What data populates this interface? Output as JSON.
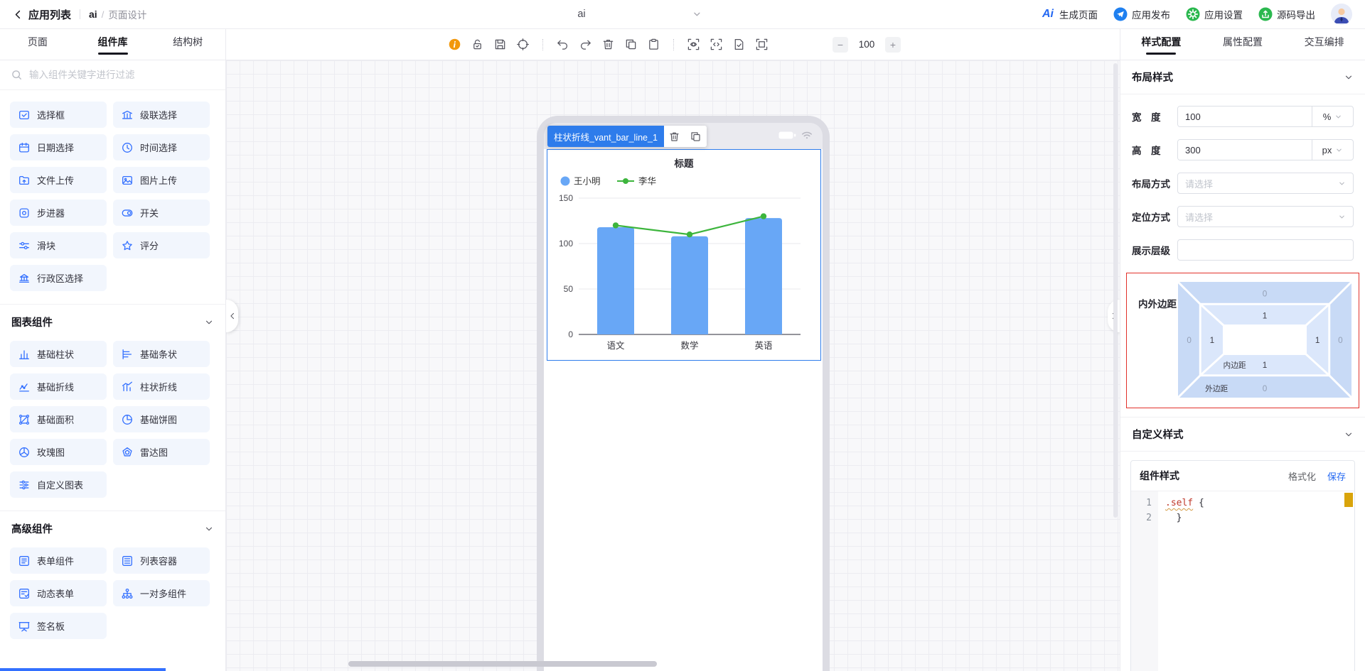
{
  "topbar": {
    "back_label": "应用列表",
    "app_name": "ai",
    "breadcrumb_divider": "/",
    "page_label": "页面设计",
    "center_title": "ai",
    "logo_text": "Ai",
    "actions": [
      {
        "id": "generate-page",
        "icon": "ai-logo",
        "label": "生成页面"
      },
      {
        "id": "app-publish",
        "icon": "publish",
        "label": "应用发布"
      },
      {
        "id": "app-settings",
        "icon": "settings",
        "label": "应用设置"
      },
      {
        "id": "source-export",
        "icon": "export",
        "label": "源码导出"
      }
    ]
  },
  "left_panel": {
    "tabs": [
      {
        "label": "页面",
        "active": false
      },
      {
        "label": "组件库",
        "active": true
      },
      {
        "label": "结构树",
        "active": false
      }
    ],
    "search_placeholder": "输入组件关键字进行过滤",
    "groups": [
      {
        "header": "",
        "items": [
          {
            "icon": "checkbox",
            "label": "选择框"
          },
          {
            "icon": "cascade",
            "label": "级联选择"
          },
          {
            "icon": "calendar",
            "label": "日期选择"
          },
          {
            "icon": "clock",
            "label": "时间选择"
          },
          {
            "icon": "file-upload",
            "label": "文件上传"
          },
          {
            "icon": "image-upload",
            "label": "图片上传"
          },
          {
            "icon": "stepper",
            "label": "步进器"
          },
          {
            "icon": "switch",
            "label": "开关"
          },
          {
            "icon": "slider",
            "label": "滑块"
          },
          {
            "icon": "star",
            "label": "评分"
          },
          {
            "icon": "district",
            "label": "行政区选择"
          }
        ]
      },
      {
        "header": "图表组件",
        "items": [
          {
            "icon": "bar-chart",
            "label": "基础柱状"
          },
          {
            "icon": "hbar-chart",
            "label": "基础条状"
          },
          {
            "icon": "line-chart",
            "label": "基础折线"
          },
          {
            "icon": "bar-line-chart",
            "label": "柱状折线"
          },
          {
            "icon": "area-chart",
            "label": "基础面积"
          },
          {
            "icon": "pie-chart",
            "label": "基础饼图"
          },
          {
            "icon": "rose-chart",
            "label": "玫瑰图"
          },
          {
            "icon": "radar-chart",
            "label": "雷达图"
          },
          {
            "icon": "custom-chart",
            "label": "自定义图表"
          }
        ]
      },
      {
        "header": "高级组件",
        "items": [
          {
            "icon": "form",
            "label": "表单组件"
          },
          {
            "icon": "list-container",
            "label": "列表容器"
          },
          {
            "icon": "dynamic-form",
            "label": "动态表单"
          },
          {
            "icon": "one-to-many",
            "label": "一对多组件"
          },
          {
            "icon": "signature",
            "label": "签名板"
          }
        ]
      }
    ]
  },
  "canvas_toolbar": {
    "icons": [
      {
        "name": "info"
      },
      {
        "name": "unlock"
      },
      {
        "name": "save"
      },
      {
        "name": "target",
        "divider_after": true
      },
      {
        "name": "undo"
      },
      {
        "name": "redo"
      },
      {
        "name": "delete"
      },
      {
        "name": "copy"
      },
      {
        "name": "paste",
        "divider_after": true
      },
      {
        "name": "preview-scan"
      },
      {
        "name": "code-scan"
      },
      {
        "name": "doc-check"
      },
      {
        "name": "frame-select"
      }
    ],
    "zoom": {
      "minus": "−",
      "value": "100",
      "plus": "+"
    }
  },
  "canvas": {
    "selected_component": "柱状折线_vant_bar_line_1"
  },
  "chart_data": {
    "type": "bar+line combo",
    "title": "标题",
    "categories": [
      "语文",
      "数学",
      "英语"
    ],
    "series": [
      {
        "name": "王小明",
        "type": "bar",
        "color": "#68a7f6",
        "values": [
          118,
          108,
          128
        ]
      },
      {
        "name": "李华",
        "type": "line",
        "color": "#3db53d",
        "values": [
          120,
          110,
          130
        ]
      }
    ],
    "ylim": [
      0,
      150
    ],
    "yticks": [
      0,
      50,
      100,
      150
    ],
    "legend_position": "top-left",
    "grid": true
  },
  "right_panel": {
    "tabs": [
      {
        "label": "样式配置",
        "active": true
      },
      {
        "label": "属性配置",
        "active": false
      },
      {
        "label": "交互编排",
        "active": false
      }
    ],
    "layout_section_title": "布局样式",
    "custom_section_title": "自定义样式",
    "fields": {
      "width": {
        "label": "宽　度",
        "value": "100",
        "unit": "%"
      },
      "height": {
        "label": "高　度",
        "value": "300",
        "unit": "px"
      },
      "layout_mode": {
        "label": "布局方式",
        "placeholder": "请选择"
      },
      "position_mode": {
        "label": "定位方式",
        "placeholder": "请选择"
      },
      "z_level": {
        "label": "展示层级",
        "value": ""
      }
    },
    "spacing": {
      "label": "内外边距",
      "padding_label": "内边距",
      "margin_label": "外边距",
      "margin": {
        "top": "0",
        "right": "0",
        "bottom": "0",
        "left": "0"
      },
      "padding": {
        "top": "1",
        "right": "1",
        "bottom": "1",
        "left": "1"
      }
    },
    "style_card": {
      "title": "组件样式",
      "format_label": "格式化",
      "save_label": "保存",
      "code": [
        {
          "num": "1",
          "tokens": [
            {
              "text": ".self",
              "type": "selector"
            },
            {
              "text": " {",
              "type": "plain"
            }
          ]
        },
        {
          "num": "2",
          "tokens": [
            {
              "text": "  }",
              "type": "plain"
            }
          ]
        }
      ]
    }
  }
}
